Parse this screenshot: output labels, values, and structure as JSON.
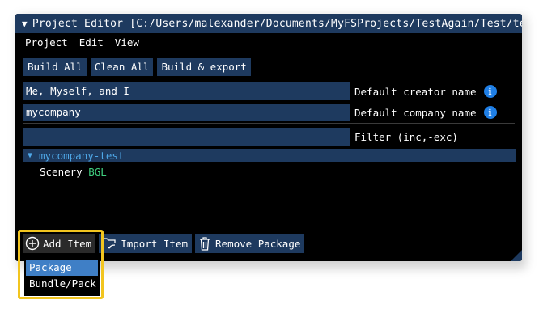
{
  "window": {
    "title": "Project Editor [C:/Users/malexander/Documents/MyFSProjects/TestAgain/Test/test/t",
    "collapse_icon": "triangle-down-icon"
  },
  "menu": {
    "items": [
      "Project",
      "Edit",
      "View"
    ]
  },
  "toolbar": {
    "build_all": "Build All",
    "clean_all": "Clean All",
    "build_export": "Build & export"
  },
  "fields": {
    "creator_value": "Me, Myself, and I",
    "creator_label": "Default creator name",
    "company_value": "mycompany",
    "company_label": "Default company name",
    "filter_value": "",
    "filter_label": "Filter (inc,-exc)",
    "info_glyph": "i"
  },
  "tree": {
    "package_name": "mycompany-test",
    "item_name": "Scenery",
    "item_type": "BGL"
  },
  "bottom": {
    "add_item": "Add Item",
    "import_item": "Import Item",
    "remove_package": "Remove Package"
  },
  "dropdown": {
    "options": [
      "Package",
      "Bundle/Pack"
    ],
    "selected": "Package"
  },
  "colors": {
    "accent": "#1e3a5f",
    "selected": "#3f7fc6",
    "highlight": "#f2c51f",
    "package_text": "#4fa8e8",
    "type_tag": "#3fcf7f",
    "info": "#1f7fe6"
  }
}
